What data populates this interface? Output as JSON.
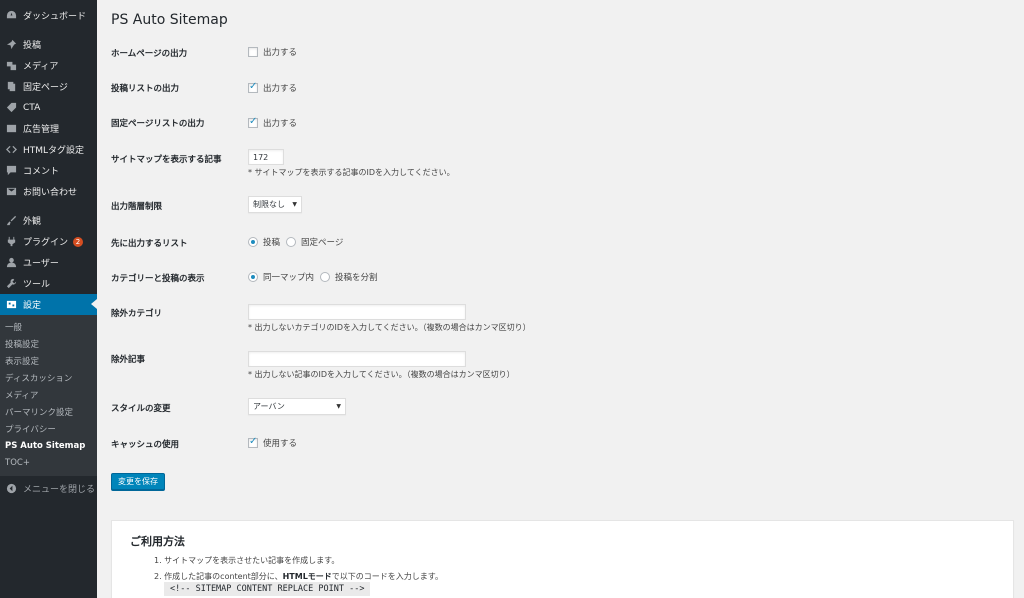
{
  "sidebar": {
    "items": [
      {
        "label": "ダッシュボード",
        "icon": "dashboard-icon"
      },
      {
        "label": "投稿",
        "icon": "pin-icon"
      },
      {
        "label": "メディア",
        "icon": "media-icon"
      },
      {
        "label": "固定ページ",
        "icon": "page-icon"
      },
      {
        "label": "CTA",
        "icon": "tag-icon"
      },
      {
        "label": "広告管理",
        "icon": "ad-icon"
      },
      {
        "label": "HTMLタグ設定",
        "icon": "code-icon"
      },
      {
        "label": "コメント",
        "icon": "comment-icon"
      },
      {
        "label": "お問い合わせ",
        "icon": "mail-icon"
      },
      {
        "label": "外観",
        "icon": "brush-icon"
      },
      {
        "label": "プラグイン",
        "icon": "plugin-icon",
        "badge": "2"
      },
      {
        "label": "ユーザー",
        "icon": "user-icon"
      },
      {
        "label": "ツール",
        "icon": "wrench-icon"
      },
      {
        "label": "設定",
        "icon": "settings-icon"
      }
    ],
    "submenu": [
      "一般",
      "投稿設定",
      "表示設定",
      "ディスカッション",
      "メディア",
      "パーマリンク設定",
      "プライバシー",
      "PS Auto Sitemap",
      "TOC+"
    ],
    "collapse_label": "メニューを閉じる",
    "accent_color": "#0073aa"
  },
  "main": {
    "title": "PS Auto Sitemap",
    "rows": {
      "home_output": {
        "label": "ホームページの出力",
        "checkbox_label": "出力する",
        "checked": false
      },
      "post_list_output": {
        "label": "投稿リストの出力",
        "checkbox_label": "出力する",
        "checked": true
      },
      "page_list_output": {
        "label": "固定ページリストの出力",
        "checkbox_label": "出力する",
        "checked": true
      },
      "sitemap_post": {
        "label": "サイトマップを表示する記事",
        "value": "172",
        "description": "* サイトマップを表示する記事のIDを入力してください。"
      },
      "depth_limit": {
        "label": "出力階層制限",
        "selected": "制限なし"
      },
      "first_list": {
        "label": "先に出力するリスト",
        "options": [
          "投稿",
          "固定ページ"
        ],
        "selected_index": 0
      },
      "category_post_display": {
        "label": "カテゴリーと投稿の表示",
        "options": [
          "同一マップ内",
          "投稿を分割"
        ],
        "selected_index": 0
      },
      "exclude_category": {
        "label": "除外カテゴリ",
        "value": "",
        "description": "* 出力しないカテゴリのIDを入力してください。（複数の場合はカンマ区切り）"
      },
      "exclude_post": {
        "label": "除外記事",
        "value": "",
        "description": "* 出力しない記事のIDを入力してください。（複数の場合はカンマ区切り）"
      },
      "style_change": {
        "label": "スタイルの変更",
        "selected": "アーバン"
      },
      "cache_use": {
        "label": "キャッシュの使用",
        "checkbox_label": "使用する",
        "checked": true
      }
    },
    "save_label": "変更を保存",
    "usage": {
      "title": "ご利用方法",
      "step1": "1. サイトマップを表示させたい記事を作成します。",
      "step2_prefix": "2. 作成した記事のcontent部分に、",
      "step2_bold": "HTMLモード",
      "step2_suffix": "で以下のコードを入力します。",
      "code": "<!-- SITEMAP CONTENT REPLACE POINT -->"
    }
  }
}
